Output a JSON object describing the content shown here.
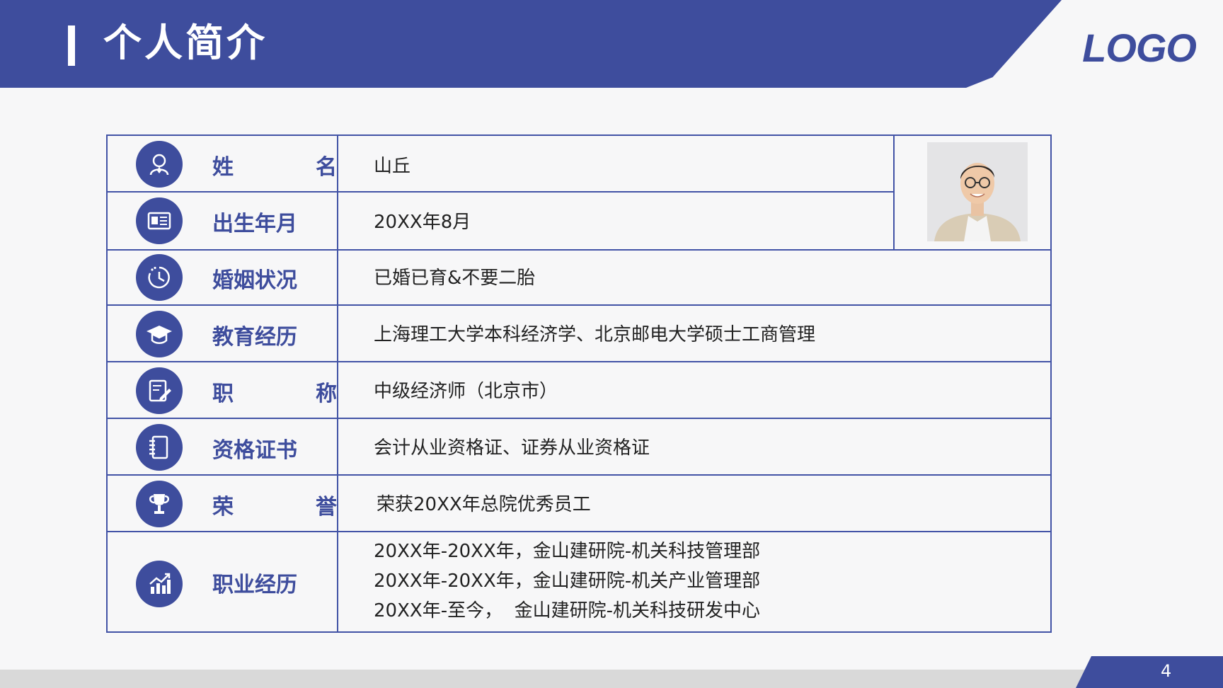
{
  "header": {
    "title": "个人简介",
    "logo": "LOGO"
  },
  "rows": [
    {
      "label": "姓名",
      "label_chars": [
        "姓",
        "名"
      ],
      "value": "山丘",
      "icon": "person-icon"
    },
    {
      "label": "出生年月",
      "value": "20XX年8月",
      "icon": "id-card-icon"
    },
    {
      "label": "婚姻状况",
      "value": "已婚已育&不要二胎",
      "icon": "clock-icon"
    },
    {
      "label": "教育经历",
      "value": "上海理工大学本科经济学、北京邮电大学硕士工商管理",
      "icon": "graduation-cap-icon"
    },
    {
      "label": "职称",
      "label_chars": [
        "职",
        "称"
      ],
      "value": "中级经济师（北京市）",
      "icon": "edit-document-icon"
    },
    {
      "label": "资格证书",
      "value": "会计从业资格证、证券从业资格证",
      "icon": "notebook-icon"
    },
    {
      "label": "荣誉",
      "label_chars": [
        "荣",
        "誉"
      ],
      "value": "荣获20XX年总院优秀员工",
      "icon": "trophy-icon"
    },
    {
      "label": "职业经历",
      "values": [
        "20XX年-20XX年，金山建研院-机关科技管理部",
        "20XX年-20XX年，金山建研院-机关产业管理部",
        "20XX年-至今，  金山建研院-机关科技研发中心"
      ],
      "icon": "chart-icon"
    }
  ],
  "footer": {
    "page_number": "4"
  },
  "colors": {
    "accent": "#3e4d9d",
    "border": "#4253a6"
  }
}
